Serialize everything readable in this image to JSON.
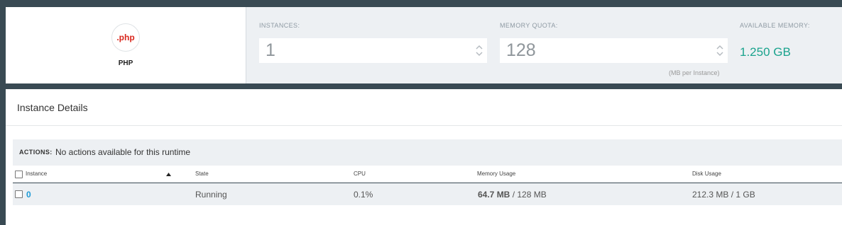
{
  "runtime": {
    "logo_text": ".php",
    "name": "PHP"
  },
  "settings": {
    "instances_label": "INSTANCES:",
    "instances_value": "1",
    "memory_quota_label": "MEMORY QUOTA:",
    "memory_quota_value": "128",
    "memory_quota_hint": "(MB per Instance)",
    "available_memory_label": "AVAILABLE MEMORY:",
    "available_memory_value": "1.250 GB"
  },
  "details": {
    "title": "Instance Details",
    "actions_label": "ACTIONS:",
    "actions_text": "No actions available for this runtime",
    "columns": [
      "Instance",
      "State",
      "CPU",
      "Memory Usage",
      "Disk Usage"
    ],
    "rows": [
      {
        "instance": "0",
        "state": "Running",
        "cpu": "0.1%",
        "memory_used": "64.7 MB",
        "memory_rest": " / 128 MB",
        "disk": "212.3 MB / 1 GB"
      }
    ]
  },
  "colors": {
    "accent_link": "#1c9ad6",
    "available_green": "#1aa38d",
    "frame": "#394a53"
  }
}
